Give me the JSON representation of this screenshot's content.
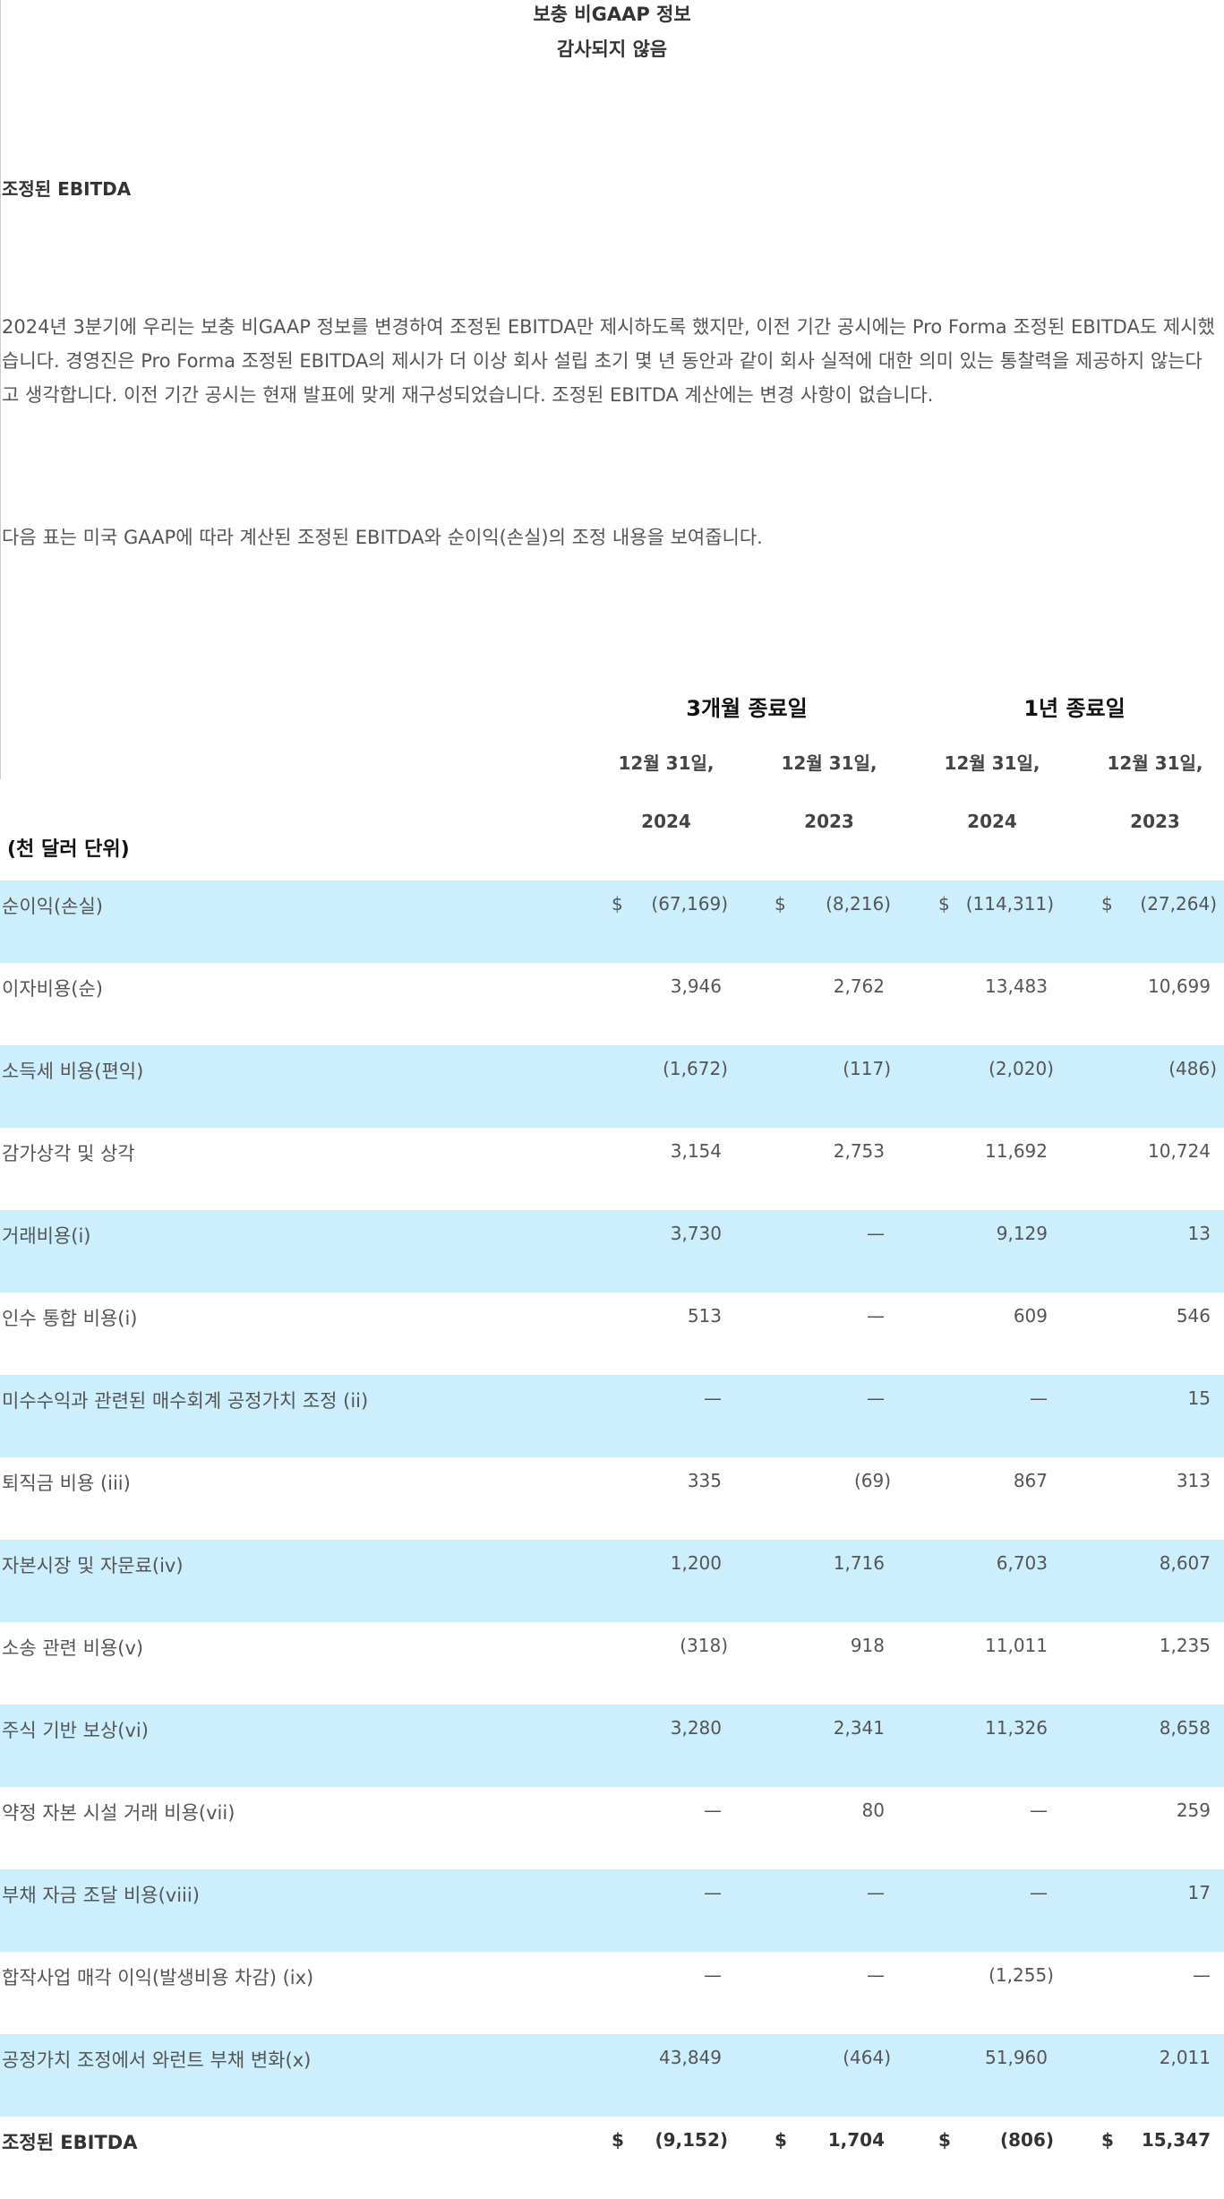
{
  "header": {
    "title": "보충 비GAAP 정보",
    "subtitle": "감사되지 않음"
  },
  "section": {
    "title": "조정된 EBITDA",
    "paragraph1": "2024년 3분기에 우리는 보충 비GAAP 정보를 변경하여 조정된 EBITDA만 제시하도록 했지만, 이전 기간 공시에는 Pro Forma 조정된 EBITDA도 제시했습니다. 경영진은 Pro Forma 조정된 EBITDA의 제시가 더 이상 회사 설립 초기 몇 년 동안과 같이 회사 실적에 대한 의미 있는 통찰력을 제공하지 않는다고 생각합니다. 이전 기간 공시는 현재 발표에 맞게 재구성되었습니다. 조정된 EBITDA 계산에는 변경 사항이 없습니다.",
    "paragraph2": "다음 표는 미국 GAAP에 따라 계산된 조정된 EBITDA와 순이익(손실)의 조정 내용을 보여줍니다."
  },
  "table": {
    "period_three_months": "3개월 종료일",
    "period_one_year": "1년 종료일",
    "unit_label": "(천 달러 단위)",
    "columns": [
      {
        "date": "12월 31일,",
        "year": "2024"
      },
      {
        "date": "12월 31일,",
        "year": "2023"
      },
      {
        "date": "12월 31일,",
        "year": "2024"
      },
      {
        "date": "12월 31일,",
        "year": "2023"
      }
    ],
    "rows": [
      {
        "label": "순이익(손실)",
        "values": [
          "(67,169)",
          "(8,216)",
          "(114,311)",
          "(27,264)"
        ],
        "dollar": "$"
      },
      {
        "label": "이자비용(순)",
        "values": [
          "3,946",
          "2,762",
          "13,483",
          "10,699"
        ]
      },
      {
        "label": "소득세 비용(편익)",
        "values": [
          "(1,672)",
          "(117)",
          "(2,020)",
          "(486)"
        ]
      },
      {
        "label": "감가상각 및 상각",
        "values": [
          "3,154",
          "2,753",
          "11,692",
          "10,724"
        ]
      },
      {
        "label": "거래비용(i)",
        "values": [
          "3,730",
          "—",
          "9,129",
          "13"
        ]
      },
      {
        "label": "인수 통합 비용(i)",
        "values": [
          "513",
          "—",
          "609",
          "546"
        ]
      },
      {
        "label": "미수수익과 관련된 매수회계 공정가치 조정 (ii)",
        "values": [
          "—",
          "—",
          "—",
          "15"
        ]
      },
      {
        "label": "퇴직금 비용 (iii)",
        "values": [
          "335",
          "(69)",
          "867",
          "313"
        ]
      },
      {
        "label": "자본시장 및 자문료(iv)",
        "values": [
          "1,200",
          "1,716",
          "6,703",
          "8,607"
        ]
      },
      {
        "label": "소송 관련 비용(v)",
        "values": [
          "(318)",
          "918",
          "11,011",
          "1,235"
        ]
      },
      {
        "label": "주식 기반 보상(vi)",
        "values": [
          "3,280",
          "2,341",
          "11,326",
          "8,658"
        ]
      },
      {
        "label": "약정 자본 시설 거래 비용(vii)",
        "values": [
          "—",
          "80",
          "—",
          "259"
        ]
      },
      {
        "label": "부채 자금 조달 비용(viii)",
        "values": [
          "—",
          "—",
          "—",
          "17"
        ]
      },
      {
        "label": "합작사업 매각 이익(발생비용 차감) (ix)",
        "values": [
          "—",
          "—",
          "(1,255)",
          "—"
        ]
      },
      {
        "label": "공정가치 조정에서 와런트 부채 변화(x)",
        "values": [
          "43,849",
          "(464)",
          "51,960",
          "2,011"
        ]
      },
      {
        "label": "조정된 EBITDA",
        "values": [
          "(9,152)",
          "1,704",
          "(806)",
          "15,347"
        ],
        "dollar": "$"
      }
    ]
  },
  "colors": {
    "row_shade": "#cdeefc",
    "text": "#555555",
    "heading": "#333333"
  }
}
